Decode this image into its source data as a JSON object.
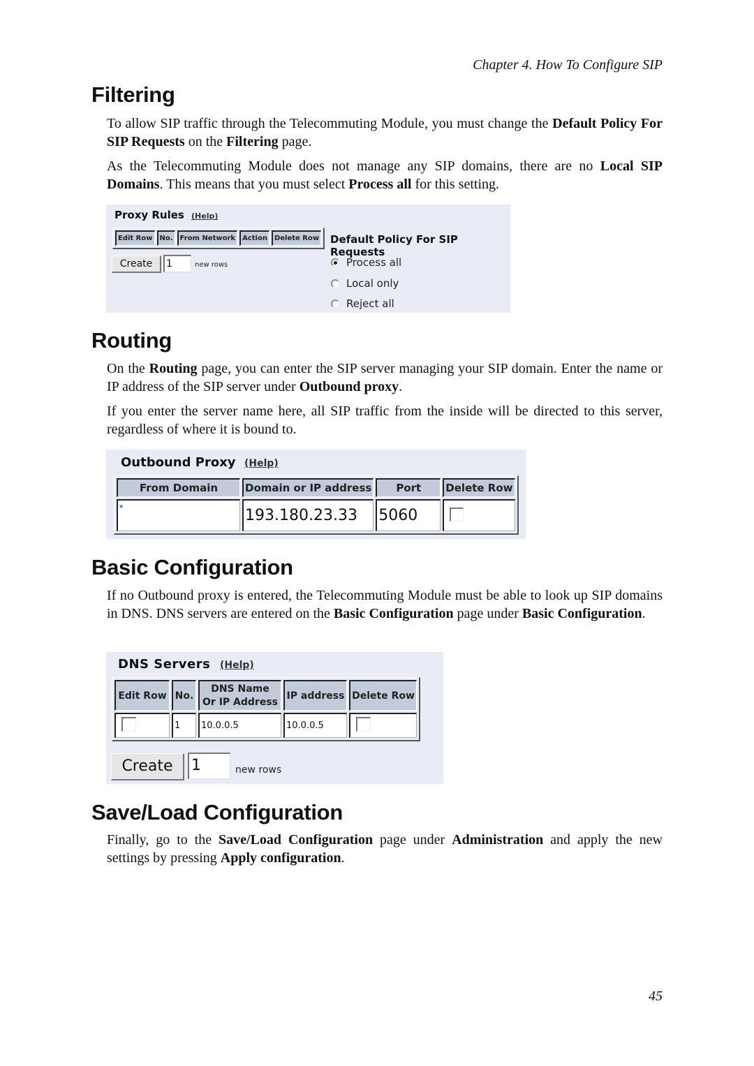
{
  "running_head": "Chapter 4. How To Configure SIP",
  "page_number": "45",
  "sections": {
    "filtering": {
      "title": "Filtering",
      "p1": [
        {
          "t": "To allow SIP traffic through the Telecommuting Module, you must change the "
        },
        {
          "b": "Default Policy For SIP Requests"
        },
        {
          "t": " on the "
        },
        {
          "b": "Filtering"
        },
        {
          "t": " page."
        }
      ],
      "p2": [
        {
          "t": "As the Telecommuting Module does not manage any SIP domains, there are no "
        },
        {
          "b": "Local SIP Domains"
        },
        {
          "t": ". This means that you must select "
        },
        {
          "b": "Process all"
        },
        {
          "t": " for this setting."
        }
      ]
    },
    "routing": {
      "title": "Routing",
      "p1": [
        {
          "t": "On the "
        },
        {
          "b": "Routing"
        },
        {
          "t": " page, you can enter the SIP server managing your SIP domain. Enter the name or IP address of the SIP server under "
        },
        {
          "b": "Outbound proxy"
        },
        {
          "t": "."
        }
      ],
      "p2": [
        {
          "t": "If you enter the server name here, all SIP traffic from the inside will be directed to this server, regardless of where it is bound to."
        }
      ]
    },
    "basic": {
      "title": "Basic Configuration",
      "p1": [
        {
          "t": "If no Outbound proxy is entered, the Telecommuting Module must be able to look up SIP domains in DNS. DNS servers are entered on the "
        },
        {
          "b": "Basic Configuration"
        },
        {
          "t": " page under "
        },
        {
          "b": "Basic Configuration"
        },
        {
          "t": "."
        }
      ]
    },
    "saveload": {
      "title": "Save/Load Configuration",
      "p1": [
        {
          "t": "Finally, go to the "
        },
        {
          "b": "Save/Load Configuration"
        },
        {
          "t": " page under "
        },
        {
          "b": "Administration"
        },
        {
          "t": " and apply the new settings by pressing "
        },
        {
          "b": "Apply configuration"
        },
        {
          "t": "."
        }
      ]
    }
  },
  "proxy_rules": {
    "title": "Proxy Rules",
    "help": "(Help)",
    "columns": [
      "Edit Row",
      "No.",
      "From Network",
      "Action",
      "Delete Row"
    ],
    "create_label": "Create",
    "new_rows_value": "1",
    "new_rows_label": "new rows",
    "policy_title": "Default Policy For SIP Requests",
    "policy_options": [
      {
        "label": "Process all",
        "checked": true
      },
      {
        "label": "Local only",
        "checked": false
      },
      {
        "label": "Reject all",
        "checked": false
      }
    ]
  },
  "outbound_proxy": {
    "title": "Outbound Proxy",
    "help": "(Help)",
    "columns": [
      "From Domain",
      "Domain or IP address",
      "Port",
      "Delete Row"
    ],
    "row": {
      "from_domain": "*",
      "domain_or_ip": "193.180.23.33",
      "port": "5060",
      "delete": false
    }
  },
  "dns_servers": {
    "title": "DNS Servers",
    "help": "(Help)",
    "columns": [
      "Edit Row",
      "No.",
      "DNS Name\nOr IP Address",
      "IP address",
      "Delete Row"
    ],
    "col_dns_line1": "DNS Name",
    "col_dns_line2": "Or IP Address",
    "row": {
      "edit": false,
      "no": "1",
      "dns_name": "10.0.0.5",
      "ip": "10.0.0.5",
      "delete": false
    },
    "create_label": "Create",
    "new_rows_value": "1",
    "new_rows_label": "new rows"
  }
}
